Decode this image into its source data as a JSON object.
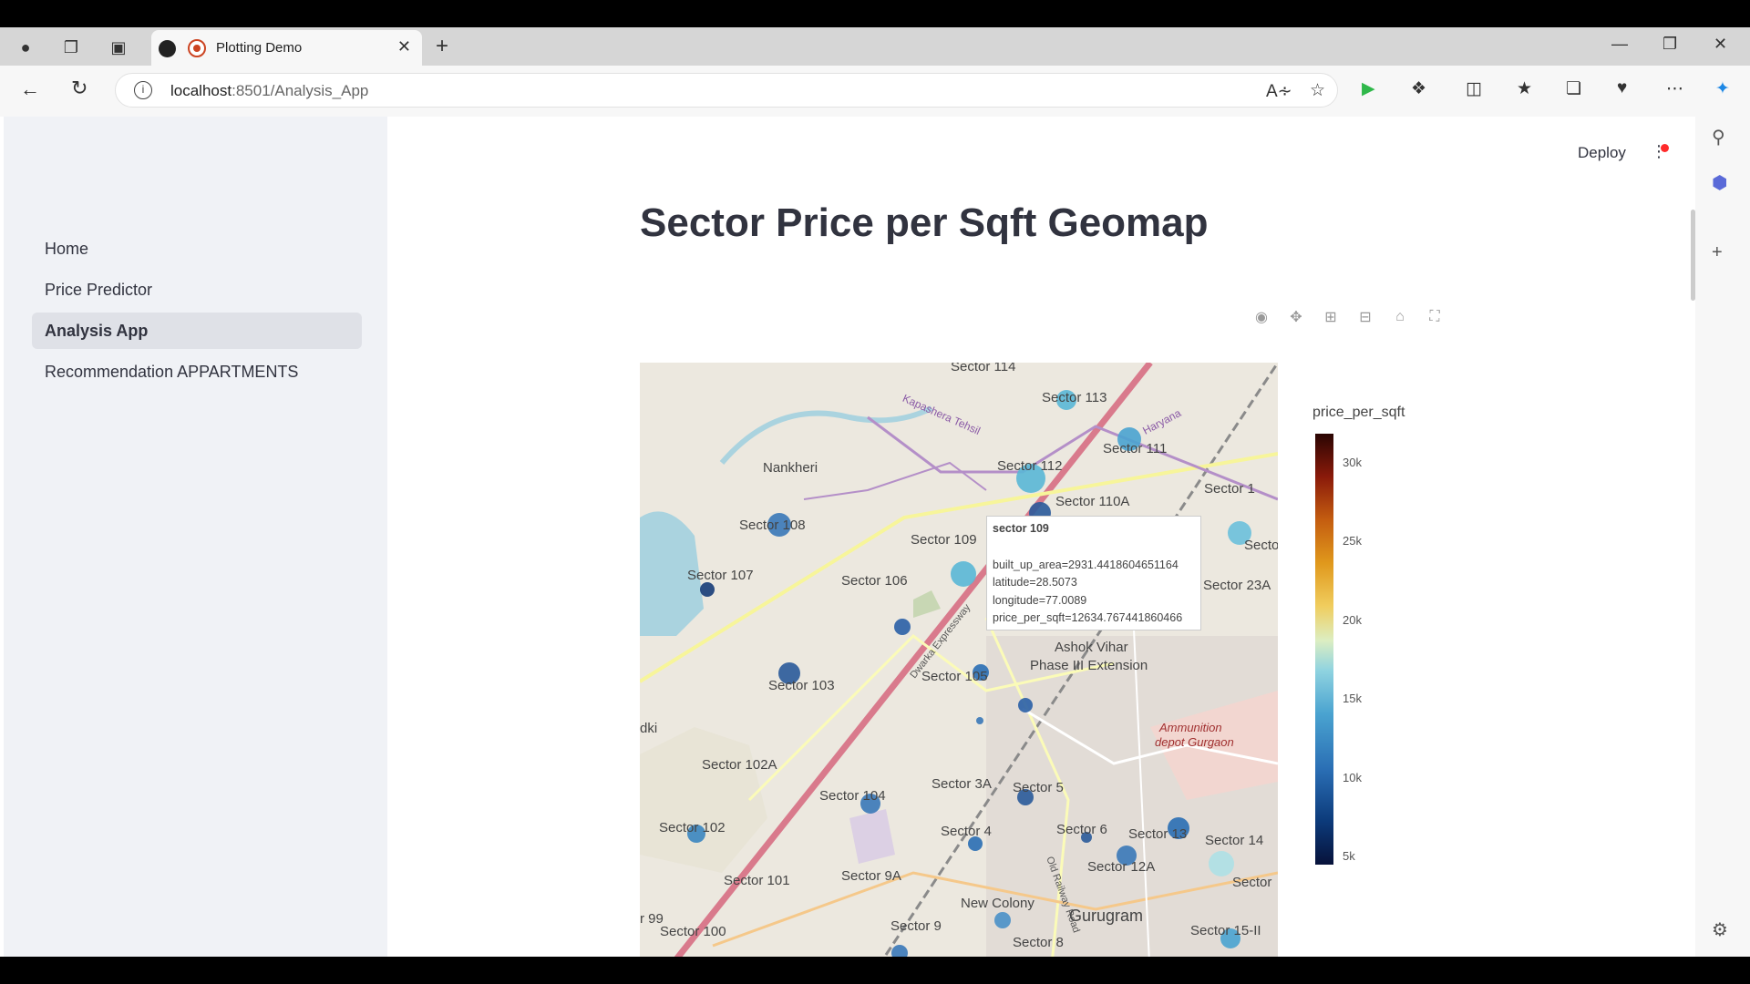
{
  "browser": {
    "tab_title": "Plotting Demo",
    "url_host": "localhost",
    "url_path": ":8501/Analysis_App"
  },
  "app": {
    "deploy_label": "Deploy",
    "page_title": "Sector Price per Sqft Geomap"
  },
  "sidebar": {
    "items": [
      {
        "label": "Home",
        "active": false
      },
      {
        "label": "Price Predictor",
        "active": false
      },
      {
        "label": "Analysis App",
        "active": true
      },
      {
        "label": "Recommendation APPARTMENTS",
        "active": false
      }
    ]
  },
  "map": {
    "labels": [
      "Sector 114",
      "Sector 113",
      "Sector 111",
      "Sector 112",
      "Sector 110A",
      "Sector 1",
      "Nankheri",
      "Sector 108",
      "Sector 109",
      "Sector 107",
      "Sector 106",
      "Sector 23A",
      "Ashok Vihar",
      "Phase III Extension",
      "Sector 105",
      "Sector 103",
      "Sector 102A",
      "Sector 104",
      "Sector 3A",
      "Sector 5",
      "Sector 102",
      "Sector 4",
      "Sector 6",
      "Sector 13",
      "Sector 14",
      "Sector 12A",
      "Sector 101",
      "Sector 9A",
      "New Colony",
      "Gurugram",
      "Sector 100",
      "Sector 9",
      "Sector 8",
      "Sector 15-II",
      "Sector",
      "Secto",
      "Kapashera Tehsil",
      "Haryana",
      "Dwarka Expressway",
      "Old Railway Road",
      "Ammunition",
      "depot Gurgaon",
      "dki",
      "r 99"
    ],
    "tooltip": {
      "name": "sector 109",
      "built_up_area": "built_up_area=2931.4418604651164",
      "latitude": "latitude=28.5073",
      "longitude": "longitude=77.0089",
      "price_per_sqft": "price_per_sqft=12634.767441860466"
    }
  },
  "colorbar": {
    "title": "price_per_sqft",
    "ticks": [
      "30k",
      "25k",
      "20k",
      "15k",
      "10k",
      "5k"
    ]
  },
  "chart_data": {
    "type": "scatter",
    "title": "Sector Price per Sqft Geomap",
    "color_variable": "price_per_sqft",
    "color_range": [
      5000,
      31000
    ],
    "points": [
      {
        "name": "sector 109",
        "latitude": 28.5073,
        "longitude": 77.0089,
        "built_up_area": 2931.4418604651164,
        "price_per_sqft": 12634.767441860466
      }
    ]
  }
}
